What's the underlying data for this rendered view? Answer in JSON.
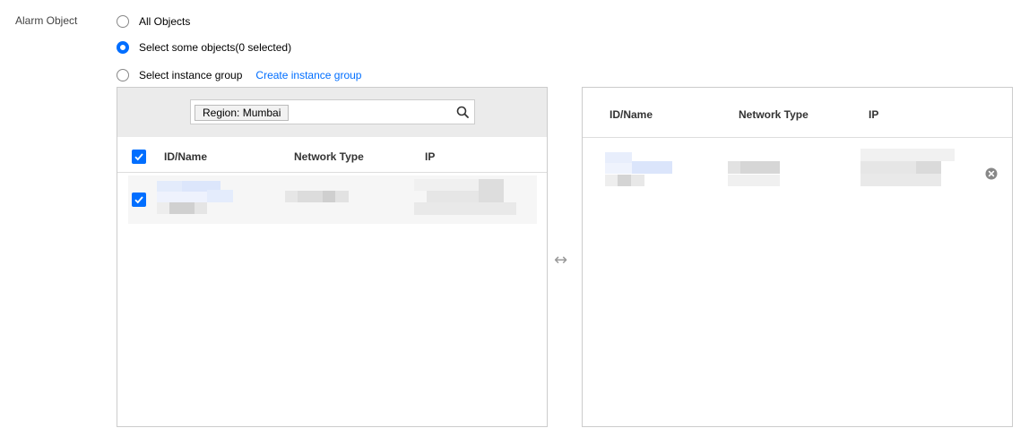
{
  "field_label": "Alarm Object",
  "options": {
    "all": {
      "label": "All Objects",
      "checked": false
    },
    "some": {
      "label": "Select some objects",
      "count_text": "(0 selected)",
      "checked": true
    },
    "group": {
      "label": "Select instance group",
      "checked": false,
      "link": "Create instance group"
    }
  },
  "left_panel": {
    "search_tag": "Region: Mumbai",
    "headers": {
      "id": "ID/Name",
      "network": "Network Type",
      "ip": "IP"
    },
    "select_all_checked": true,
    "rows": [
      {
        "checked": true
      }
    ]
  },
  "transfer_icon": "↔",
  "right_panel": {
    "headers": {
      "id": "ID/Name",
      "network": "Network Type",
      "ip": "IP"
    }
  },
  "icons": {
    "search": "search-icon",
    "remove": "close-circle-icon",
    "check": "check-icon"
  },
  "colors": {
    "accent": "#006eff",
    "header_bg": "#ebebeb",
    "border": "#cccccc"
  }
}
